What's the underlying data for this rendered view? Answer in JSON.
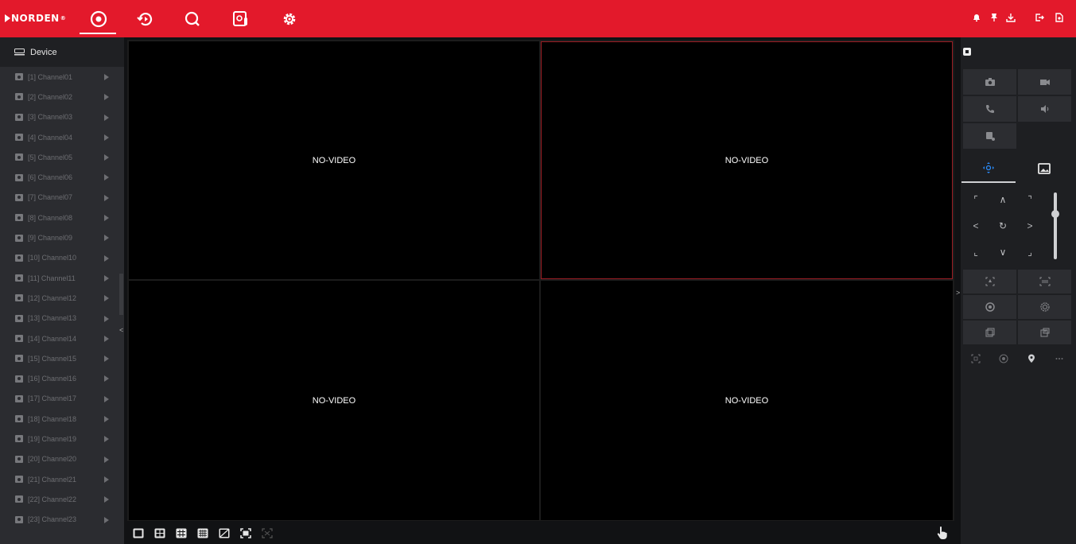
{
  "brand": {
    "logo_text": "NORDEN",
    "trademark": "®"
  },
  "top_nav": {
    "items": [
      {
        "id": "live",
        "icon": "live-view-icon",
        "active": true
      },
      {
        "id": "playback",
        "icon": "playback-icon",
        "active": false
      },
      {
        "id": "search",
        "icon": "search-icon",
        "active": false
      },
      {
        "id": "thermal",
        "icon": "thermal-icon",
        "active": false
      },
      {
        "id": "settings",
        "icon": "gear-icon",
        "active": false
      }
    ],
    "right_icons": [
      "alarm-bell-icon",
      "pin-icon",
      "download-icon",
      "logout-icon",
      "file-icon"
    ]
  },
  "sidebar": {
    "title": "Device",
    "channels": [
      "[1] Channel01",
      "[2] Channel02",
      "[3] Channel03",
      "[4] Channel04",
      "[5] Channel05",
      "[6] Channel06",
      "[7] Channel07",
      "[8] Channel08",
      "[9] Channel09",
      "[10] Channel10",
      "[11] Channel11",
      "[12] Channel12",
      "[13] Channel13",
      "[14] Channel14",
      "[15] Channel15",
      "[16] Channel16",
      "[17] Channel17",
      "[18] Channel18",
      "[19] Channel19",
      "[20] Channel20",
      "[21] Channel21",
      "[22] Channel22",
      "[23] Channel23"
    ]
  },
  "video": {
    "panes": [
      {
        "label": "NO-VIDEO",
        "selected": false
      },
      {
        "label": "NO-VIDEO",
        "selected": true
      },
      {
        "label": "NO-VIDEO",
        "selected": false
      },
      {
        "label": "NO-VIDEO",
        "selected": false
      }
    ]
  },
  "bottom_toolbar": {
    "layouts": [
      "layout-1-icon",
      "layout-4-icon",
      "layout-9-icon",
      "layout-16-icon",
      "layout-custom-icon",
      "fullscreen-icon",
      "fit-icon"
    ],
    "right_icon": "hand-pointer-icon"
  },
  "ptz_panel": {
    "action_buttons": [
      "snapshot-icon",
      "record-icon",
      "talk-icon",
      "audio-icon",
      "thermal-snapshot-icon"
    ],
    "tabs": [
      "ptz-tab-icon",
      "image-tab-icon"
    ],
    "direction_pad": [
      "up-left",
      "up",
      "up-right",
      "left",
      "auto",
      "right",
      "down-left",
      "down",
      "down-right"
    ],
    "extra_icons": [
      "focus-icon",
      "zoom-icon",
      "iris-open-icon",
      "iris-close-icon",
      "preset-icon",
      "patrol-icon",
      "area-scan-icon",
      "position-icon",
      "location-icon",
      "more-icon"
    ]
  },
  "colors": {
    "brand_red": "#e3192b",
    "selected_border": "#9c1d24"
  }
}
